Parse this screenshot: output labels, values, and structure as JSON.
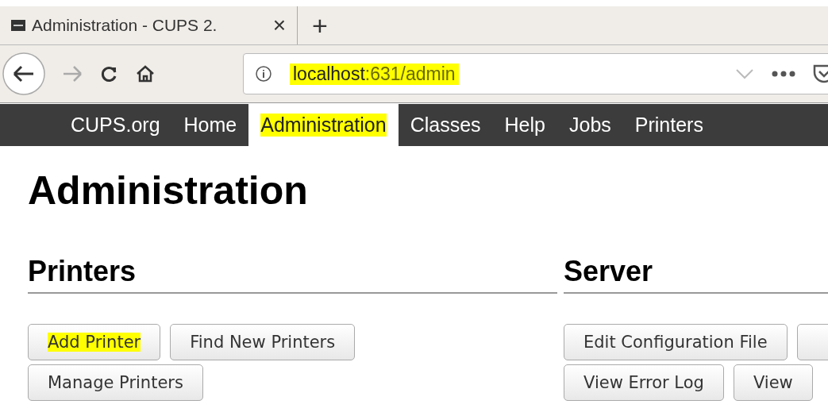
{
  "browser": {
    "tab": {
      "title": "Administration - CUPS 2."
    },
    "new_tab": "+",
    "close": "×",
    "address": {
      "host": "localhost",
      "rest": ":631/admin",
      "highlighted": true
    }
  },
  "nav": [
    {
      "label": "CUPS.org",
      "selected": false,
      "highlighted": false
    },
    {
      "label": "Home",
      "selected": false,
      "highlighted": false
    },
    {
      "label": "Administration",
      "selected": true,
      "highlighted": true
    },
    {
      "label": "Classes",
      "selected": false,
      "highlighted": false
    },
    {
      "label": "Help",
      "selected": false,
      "highlighted": false
    },
    {
      "label": "Jobs",
      "selected": false,
      "highlighted": false
    },
    {
      "label": "Printers",
      "selected": false,
      "highlighted": false
    }
  ],
  "page_title": "Administration",
  "sections": [
    {
      "title": "Printers",
      "rows": [
        [
          {
            "label": "Add Printer",
            "highlighted": true
          },
          {
            "label": "Find New Printers",
            "highlighted": false
          }
        ],
        [
          {
            "label": "Manage Printers",
            "highlighted": false
          }
        ]
      ]
    },
    {
      "title": "Server",
      "rows": [
        [
          {
            "label": "Edit Configuration File",
            "highlighted": false
          },
          {
            "highlighted": false
          }
        ],
        [
          {
            "label": "View Error Log",
            "highlighted": false
          },
          {
            "label": "View",
            "highlighted": false
          }
        ]
      ]
    }
  ]
}
